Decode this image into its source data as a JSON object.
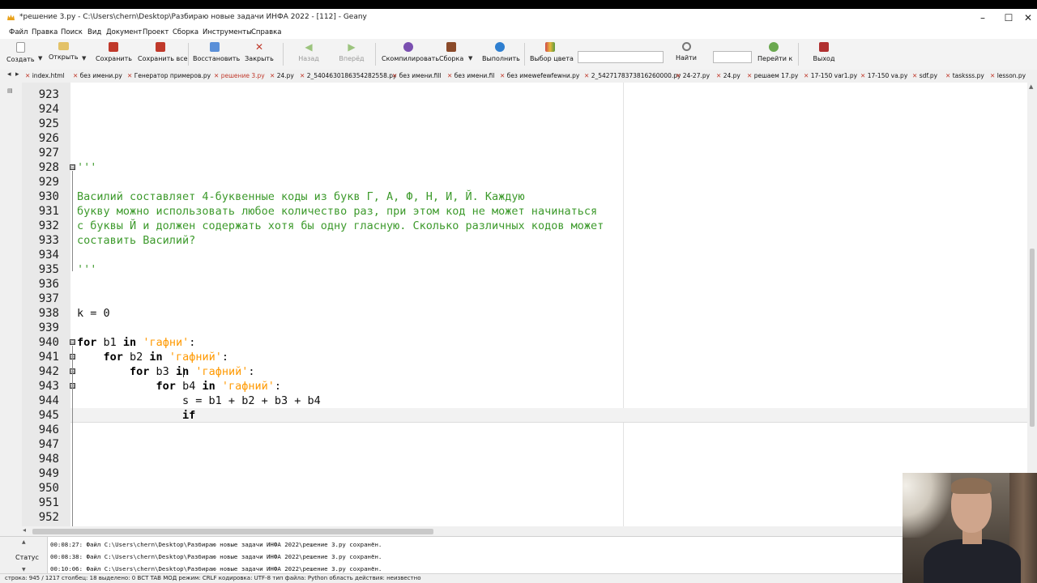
{
  "window": {
    "title": "*решение 3.py - C:\\Users\\chern\\Desktop\\Разбираю новые задачи ИНФА 2022 - [112] - Geany",
    "controls": {
      "minimize": "–",
      "maximize": "☐",
      "close": "✕"
    }
  },
  "menu": [
    "Файл",
    "Правка",
    "Поиск",
    "Вид",
    "Документ",
    "Проект",
    "Сборка",
    "Инструменты",
    "Справка"
  ],
  "toolbar": {
    "create": "Создать",
    "open": "Открыть",
    "save": "Сохранить",
    "save_all": "Сохранить все",
    "revert": "Восстановить",
    "close": "Закрыть",
    "back": "Назад",
    "forward": "Вперёд",
    "compile": "Скомпилировать",
    "build": "Сборка",
    "execute": "Выполнить",
    "color_chooser": "Выбор цвета",
    "search_value": "",
    "find": "Найти",
    "goto_value": "",
    "goto": "Перейти к",
    "quit": "Выход",
    "colors": {
      "save": "#c0392b",
      "close": "#c0392b",
      "nav": "#7fba5a",
      "run": "#2f7fd0",
      "color": "#d04a4a"
    }
  },
  "tabs": {
    "nav_left": "◂",
    "nav_right": "▸",
    "items": [
      {
        "label": "index.html",
        "active": false
      },
      {
        "label": "без имени.py",
        "active": false
      },
      {
        "label": "Генератор примеров.py",
        "active": false
      },
      {
        "label": "решение 3.py",
        "active": true
      },
      {
        "label": "24.py",
        "active": false
      },
      {
        "label": "2_5404630186354282558.py",
        "active": false
      },
      {
        "label": "без имени.fill",
        "active": false
      },
      {
        "label": "без имени.fil",
        "active": false
      },
      {
        "label": "без имеwefewfewни.py",
        "active": false
      },
      {
        "label": "2_5427178373816260000.py",
        "active": false
      },
      {
        "label": "24-27.py",
        "active": false
      },
      {
        "label": "24.py",
        "active": false
      },
      {
        "label": "решаем 17.py",
        "active": false
      },
      {
        "label": "17-150 var1.py",
        "active": false
      },
      {
        "label": "17-150 va.py",
        "active": false
      },
      {
        "label": "sdf.py",
        "active": false
      },
      {
        "label": "tasksss.py",
        "active": false
      },
      {
        "label": "lesson.py",
        "active": false
      }
    ],
    "close_glyph": "✕"
  },
  "editor": {
    "line_numbers": [
      "923",
      "924",
      "925",
      "926",
      "927",
      "928",
      "929",
      "930",
      "931",
      "932",
      "933",
      "934",
      "935",
      "936",
      "937",
      "938",
      "939",
      "940",
      "941",
      "942",
      "943",
      "944",
      "945",
      "946",
      "947",
      "948",
      "949",
      "950",
      "951",
      "952"
    ],
    "code": {
      "l928": "'''",
      "l930": "Василий составляет 4-буквенные коды из букв Г, А, Ф, Н, И, Й. Каждую",
      "l931": "букву можно использовать любое количество раз, при этом код не может начинаться",
      "l932": "с буквы Й и должен содержать хотя бы одну гласную. Сколько различных кодов может",
      "l933": "составить Василий?",
      "l935": "'''",
      "l938": "k = 0",
      "l940_kw1": "for",
      "l940_var": " b1 ",
      "l940_kw2": "in",
      "l940_str": "'гафни'",
      "l940_end": ":",
      "l941_indent": "    ",
      "l941_kw1": "for",
      "l941_var": " b2 ",
      "l941_kw2": "in",
      "l941_str": "'гафний'",
      "l941_end": ":",
      "l942_indent": "        ",
      "l942_kw1": "for",
      "l942_var": " b3 ",
      "l942_kw2": "in",
      "l942_str": "'гафний'",
      "l942_end": ":",
      "l943_indent": "            ",
      "l943_kw1": "for",
      "l943_var": " b4 ",
      "l943_kw2": "in",
      "l943_str": "'гафний'",
      "l943_end": ":",
      "l944": "                s = b1 + b2 + b3 + b4",
      "l945_indent": "                ",
      "l945_kw": "if"
    },
    "fold_glyph": "⊟"
  },
  "messages": {
    "tab_label": "Статус",
    "items": [
      "00:08:27: Файл C:\\Users\\chern\\Desktop\\Разбираю новые задачи ИНФА 2022\\решение 3.py сохранён.",
      "00:08:38: Файл C:\\Users\\chern\\Desktop\\Разбираю новые задачи ИНФА 2022\\решение 3.py сохранён.",
      "00:10:06: Файл C:\\Users\\chern\\Desktop\\Разбираю новые задачи ИНФА 2022\\решение 3.py сохранён."
    ]
  },
  "statusbar": {
    "text": "строка: 945 / 1217     столбец: 18    выделено: 0   ВСТ     TAB     МОД     режим: CRLF     кодировка: UTF-8     тип файла: Python     область действия: неизвестно"
  }
}
